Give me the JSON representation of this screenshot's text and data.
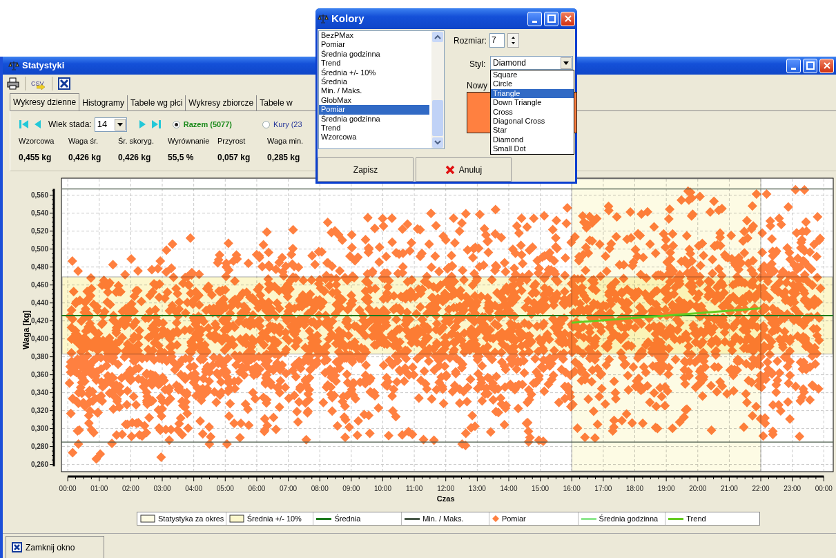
{
  "window": {
    "title": "Statystyki"
  },
  "toolbar": [
    {
      "kind": "print"
    },
    {
      "kind": "csv",
      "label": "CSV"
    },
    {
      "kind": "close"
    }
  ],
  "tabs": [
    {
      "label": "Wykresy dzienne",
      "selected": true
    },
    {
      "label": "Histogramy",
      "selected": false
    },
    {
      "label": "Tabele wg płci",
      "selected": false
    },
    {
      "label": "Wykresy zbiorcze",
      "selected": false
    },
    {
      "label": "Tabele w",
      "selected": false
    }
  ],
  "controls": {
    "age_label": "Wiek stada:",
    "age_value": "14",
    "radios": [
      {
        "label": "Razem (5077)",
        "selected": true
      },
      {
        "label": "Kury (23",
        "selected": false
      }
    ]
  },
  "stats": [
    {
      "label": "Wzorcowa",
      "value": "0,455 kg"
    },
    {
      "label": "Waga śr.",
      "value": "0,426 kg"
    },
    {
      "label": "Śr. skoryg.",
      "value": "0,426 kg"
    },
    {
      "label": "Wyrównanie",
      "value": "55,5 %"
    },
    {
      "label": "Przyrost",
      "value": "0,057 kg"
    },
    {
      "label": "Waga min.",
      "value": "0,285 kg"
    }
  ],
  "chart": {
    "chart_data": {
      "type": "line",
      "xlabel": "Czas",
      "ylabel": "Waga [kg]",
      "xlim": [
        -0.2,
        24.3
      ],
      "ylim": [
        0.252,
        0.579
      ],
      "grid": true,
      "x": [
        -0.2,
        16,
        22,
        24.3
      ],
      "series": [
        {
          "name": "Średnia",
          "color": "#1e7b1e",
          "values": [
            0.426,
            0.426,
            0.426,
            0.426
          ]
        },
        {
          "name": "Min. / Maks.",
          "color": "#4a5a4a",
          "values": [
            0.285,
            0.285,
            0.285,
            0.285
          ]
        },
        {
          "name": "Trend",
          "color": "#66cc22",
          "values": [
            null,
            0.418,
            0.434,
            null
          ]
        }
      ],
      "ref_lines": [
        {
          "axis": "y",
          "value": 0.567,
          "color": "#4a5a4a"
        }
      ],
      "bands": [
        {
          "axis": "x",
          "from": 16,
          "to": 22,
          "label": "Statystyka za okres",
          "color": "#fdfbe4"
        },
        {
          "axis": "y",
          "from": 0.383,
          "to": 0.469,
          "label": "Średnia +/- 10%",
          "color": "#fcf7cc"
        }
      ],
      "xticks": [
        {
          "value": 0,
          "label": "00:00"
        },
        {
          "value": 1,
          "label": "01:00"
        },
        {
          "value": 2,
          "label": "02:00"
        },
        {
          "value": 3,
          "label": "03:00"
        },
        {
          "value": 4,
          "label": "04:00"
        },
        {
          "value": 5,
          "label": "05:00"
        },
        {
          "value": 6,
          "label": "06:00"
        },
        {
          "value": 7,
          "label": "07:00"
        },
        {
          "value": 8,
          "label": "08:00"
        },
        {
          "value": 9,
          "label": "09:00"
        },
        {
          "value": 10,
          "label": "10:00"
        },
        {
          "value": 11,
          "label": "11:00"
        },
        {
          "value": 12,
          "label": "12:00"
        },
        {
          "value": 13,
          "label": "13:00"
        },
        {
          "value": 14,
          "label": "14:00"
        },
        {
          "value": 15,
          "label": "15:00"
        },
        {
          "value": 16,
          "label": "16:00"
        },
        {
          "value": 17,
          "label": "17:00"
        },
        {
          "value": 18,
          "label": "18:00"
        },
        {
          "value": 19,
          "label": "19:00"
        },
        {
          "value": 20,
          "label": "20:00"
        },
        {
          "value": 21,
          "label": "21:00"
        },
        {
          "value": 22,
          "label": "22:00"
        },
        {
          "value": 23,
          "label": "23:00"
        },
        {
          "value": 24,
          "label": "00:00"
        }
      ],
      "yticks": [
        {
          "value": 0.26,
          "label": "0,260"
        },
        {
          "value": 0.28,
          "label": "0,280"
        },
        {
          "value": 0.3,
          "label": "0,300"
        },
        {
          "value": 0.32,
          "label": "0,320"
        },
        {
          "value": 0.34,
          "label": "0,340"
        },
        {
          "value": 0.36,
          "label": "0,360"
        },
        {
          "value": 0.38,
          "label": "0,380"
        },
        {
          "value": 0.4,
          "label": "0,400"
        },
        {
          "value": 0.42,
          "label": "0,420"
        },
        {
          "value": 0.44,
          "label": "0,440"
        },
        {
          "value": 0.46,
          "label": "0,460"
        },
        {
          "value": 0.48,
          "label": "0,480"
        },
        {
          "value": 0.5,
          "label": "0,500"
        },
        {
          "value": 0.52,
          "label": "0,520"
        },
        {
          "value": 0.54,
          "label": "0,540"
        },
        {
          "value": 0.56,
          "label": "0,560"
        }
      ]
    }
  },
  "legend": [
    {
      "kind": "band"
    },
    {
      "kind": "band"
    },
    {
      "kind": "series"
    },
    {
      "kind": "series"
    },
    {
      "kind": "marker",
      "label": "Pomiar",
      "color": "#ff8040"
    },
    {
      "kind": "line",
      "label": "Średnia godzinna",
      "color": "#90e890"
    },
    {
      "kind": "series"
    }
  ],
  "close_button": "Zamknij okno",
  "dialog": {
    "title": "Kolory",
    "series_list": [
      {
        "label": "BezPMax",
        "selected": false
      },
      {
        "label": "Pomiar",
        "selected": false
      },
      {
        "label": "Średnia godzinna",
        "selected": false
      },
      {
        "label": "Trend",
        "selected": false
      },
      {
        "label": "Średnia +/- 10%",
        "selected": false
      },
      {
        "label": "Średnia",
        "selected": false
      },
      {
        "label": "Min. / Maks.",
        "selected": false
      },
      {
        "label": "GlobMax",
        "selected": false
      },
      {
        "label": "Pomiar",
        "selected": true
      },
      {
        "label": "Średnia godzinna",
        "selected": false
      },
      {
        "label": "Trend",
        "selected": false
      },
      {
        "label": "Wzorcowa",
        "selected": false
      }
    ],
    "size_label": "Rozmiar:",
    "size_value": "7",
    "style_label": "Styl:",
    "style_value": "Diamond",
    "style_options": [
      {
        "label": "Square",
        "selected": false
      },
      {
        "label": "Circle",
        "selected": false
      },
      {
        "label": "Triangle",
        "selected": true
      },
      {
        "label": "Down Triangle",
        "selected": false
      },
      {
        "label": "Cross",
        "selected": false
      },
      {
        "label": "Diagonal Cross",
        "selected": false
      },
      {
        "label": "Star",
        "selected": false
      },
      {
        "label": "Diamond",
        "selected": false
      },
      {
        "label": "Small Dot",
        "selected": false
      }
    ],
    "preview_label": "Nowy",
    "buttons": [
      {
        "label": "Zapisz",
        "kind": "save"
      },
      {
        "label": "Anuluj",
        "kind": "cancel"
      }
    ]
  }
}
